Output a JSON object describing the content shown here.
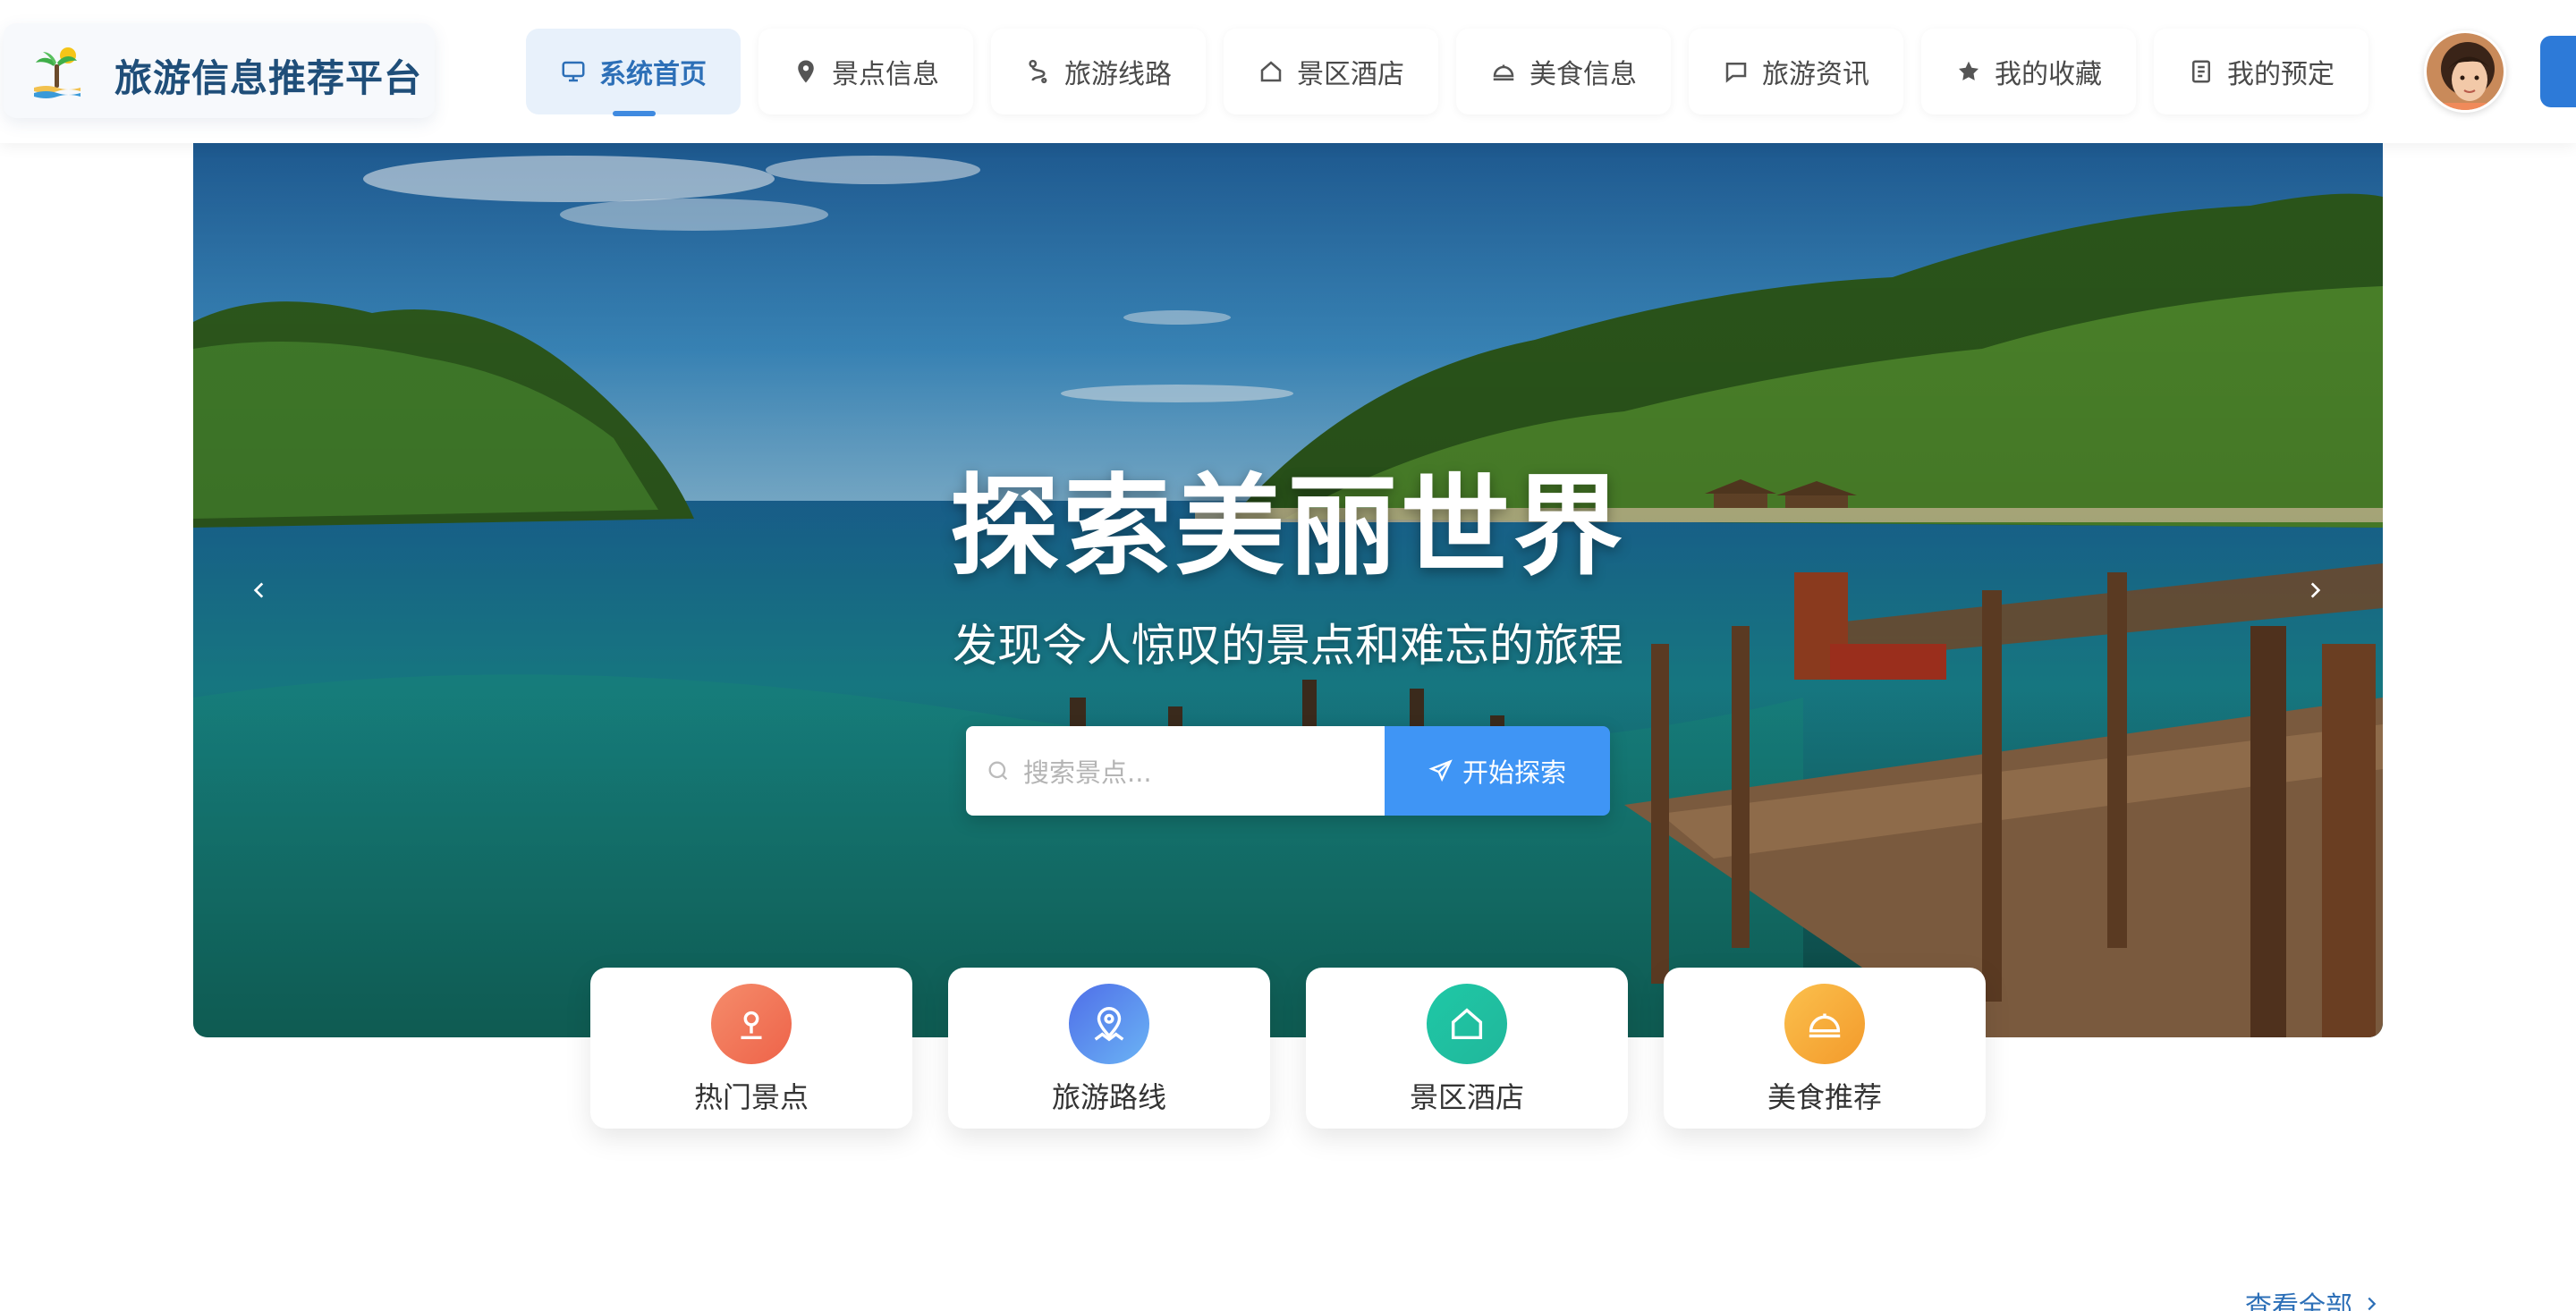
{
  "app": {
    "title": "旅游信息推荐平台"
  },
  "nav": {
    "items": [
      {
        "label": "系统首页",
        "icon": "monitor-icon",
        "active": true
      },
      {
        "label": "景点信息",
        "icon": "map-pin-icon"
      },
      {
        "label": "旅游线路",
        "icon": "route-icon"
      },
      {
        "label": "景区酒店",
        "icon": "house-icon"
      },
      {
        "label": "美食信息",
        "icon": "food-dome-icon"
      },
      {
        "label": "旅游资讯",
        "icon": "chat-icon"
      },
      {
        "label": "我的收藏",
        "icon": "star-icon"
      },
      {
        "label": "我的预定",
        "icon": "document-icon"
      }
    ]
  },
  "hero": {
    "title": "探索美丽世界",
    "subtitle": "发现令人惊叹的景点和难忘的旅程",
    "search_placeholder": "搜索景点...",
    "search_button": "开始探索"
  },
  "quick_links": [
    {
      "label": "热门景点",
      "icon": "location-pin-icon",
      "color": "#f27a5e"
    },
    {
      "label": "旅游路线",
      "icon": "map-location-icon",
      "color": "#5b7ff0"
    },
    {
      "label": "景区酒店",
      "icon": "house-icon",
      "color": "#22c6a3"
    },
    {
      "label": "美食推荐",
      "icon": "food-dome-icon",
      "color": "#f6a935"
    }
  ],
  "section": {
    "view_all": "查看全部"
  },
  "colors": {
    "primary": "#2c6fb7",
    "accent": "#3f95f5",
    "nav_active_bg": "#e8f1fb"
  }
}
